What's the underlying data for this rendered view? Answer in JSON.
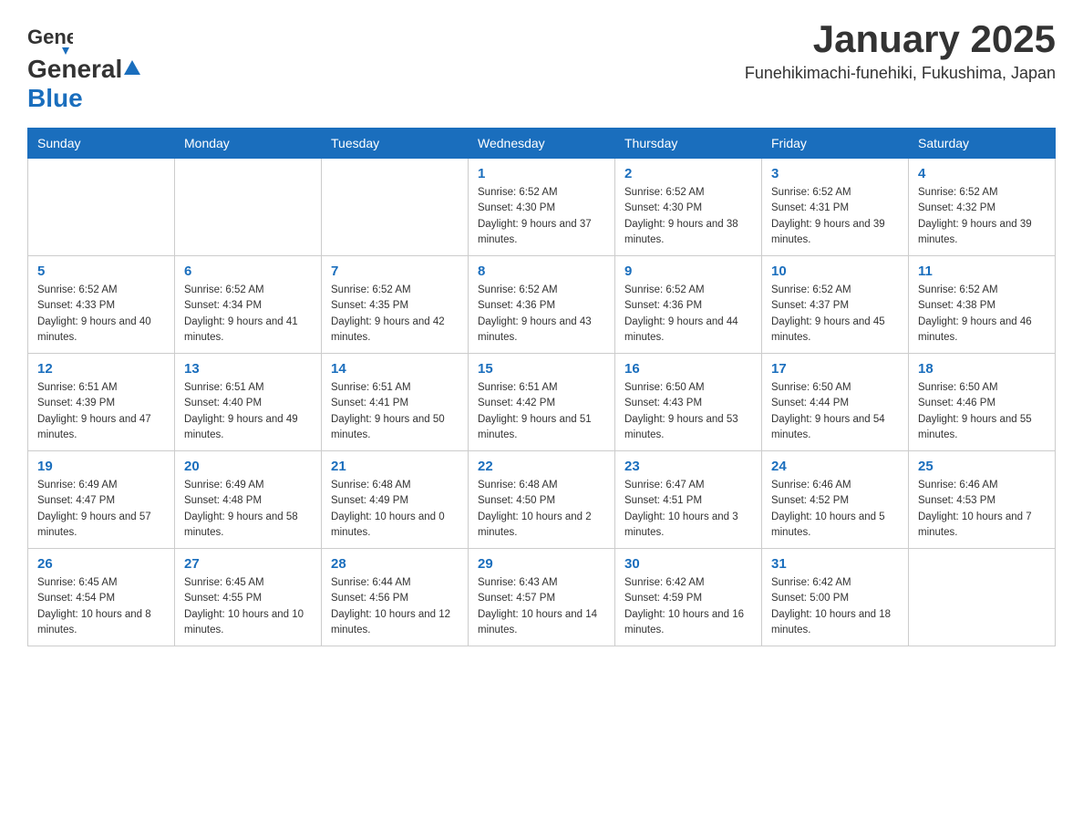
{
  "header": {
    "logo": {
      "general": "General",
      "blue": "Blue"
    },
    "title": "January 2025",
    "subtitle": "Funehikimachi-funehiki, Fukushima, Japan"
  },
  "days_of_week": [
    "Sunday",
    "Monday",
    "Tuesday",
    "Wednesday",
    "Thursday",
    "Friday",
    "Saturday"
  ],
  "weeks": [
    [
      {
        "day": "",
        "info": ""
      },
      {
        "day": "",
        "info": ""
      },
      {
        "day": "",
        "info": ""
      },
      {
        "day": "1",
        "info": "Sunrise: 6:52 AM\nSunset: 4:30 PM\nDaylight: 9 hours and 37 minutes."
      },
      {
        "day": "2",
        "info": "Sunrise: 6:52 AM\nSunset: 4:30 PM\nDaylight: 9 hours and 38 minutes."
      },
      {
        "day": "3",
        "info": "Sunrise: 6:52 AM\nSunset: 4:31 PM\nDaylight: 9 hours and 39 minutes."
      },
      {
        "day": "4",
        "info": "Sunrise: 6:52 AM\nSunset: 4:32 PM\nDaylight: 9 hours and 39 minutes."
      }
    ],
    [
      {
        "day": "5",
        "info": "Sunrise: 6:52 AM\nSunset: 4:33 PM\nDaylight: 9 hours and 40 minutes."
      },
      {
        "day": "6",
        "info": "Sunrise: 6:52 AM\nSunset: 4:34 PM\nDaylight: 9 hours and 41 minutes."
      },
      {
        "day": "7",
        "info": "Sunrise: 6:52 AM\nSunset: 4:35 PM\nDaylight: 9 hours and 42 minutes."
      },
      {
        "day": "8",
        "info": "Sunrise: 6:52 AM\nSunset: 4:36 PM\nDaylight: 9 hours and 43 minutes."
      },
      {
        "day": "9",
        "info": "Sunrise: 6:52 AM\nSunset: 4:36 PM\nDaylight: 9 hours and 44 minutes."
      },
      {
        "day": "10",
        "info": "Sunrise: 6:52 AM\nSunset: 4:37 PM\nDaylight: 9 hours and 45 minutes."
      },
      {
        "day": "11",
        "info": "Sunrise: 6:52 AM\nSunset: 4:38 PM\nDaylight: 9 hours and 46 minutes."
      }
    ],
    [
      {
        "day": "12",
        "info": "Sunrise: 6:51 AM\nSunset: 4:39 PM\nDaylight: 9 hours and 47 minutes."
      },
      {
        "day": "13",
        "info": "Sunrise: 6:51 AM\nSunset: 4:40 PM\nDaylight: 9 hours and 49 minutes."
      },
      {
        "day": "14",
        "info": "Sunrise: 6:51 AM\nSunset: 4:41 PM\nDaylight: 9 hours and 50 minutes."
      },
      {
        "day": "15",
        "info": "Sunrise: 6:51 AM\nSunset: 4:42 PM\nDaylight: 9 hours and 51 minutes."
      },
      {
        "day": "16",
        "info": "Sunrise: 6:50 AM\nSunset: 4:43 PM\nDaylight: 9 hours and 53 minutes."
      },
      {
        "day": "17",
        "info": "Sunrise: 6:50 AM\nSunset: 4:44 PM\nDaylight: 9 hours and 54 minutes."
      },
      {
        "day": "18",
        "info": "Sunrise: 6:50 AM\nSunset: 4:46 PM\nDaylight: 9 hours and 55 minutes."
      }
    ],
    [
      {
        "day": "19",
        "info": "Sunrise: 6:49 AM\nSunset: 4:47 PM\nDaylight: 9 hours and 57 minutes."
      },
      {
        "day": "20",
        "info": "Sunrise: 6:49 AM\nSunset: 4:48 PM\nDaylight: 9 hours and 58 minutes."
      },
      {
        "day": "21",
        "info": "Sunrise: 6:48 AM\nSunset: 4:49 PM\nDaylight: 10 hours and 0 minutes."
      },
      {
        "day": "22",
        "info": "Sunrise: 6:48 AM\nSunset: 4:50 PM\nDaylight: 10 hours and 2 minutes."
      },
      {
        "day": "23",
        "info": "Sunrise: 6:47 AM\nSunset: 4:51 PM\nDaylight: 10 hours and 3 minutes."
      },
      {
        "day": "24",
        "info": "Sunrise: 6:46 AM\nSunset: 4:52 PM\nDaylight: 10 hours and 5 minutes."
      },
      {
        "day": "25",
        "info": "Sunrise: 6:46 AM\nSunset: 4:53 PM\nDaylight: 10 hours and 7 minutes."
      }
    ],
    [
      {
        "day": "26",
        "info": "Sunrise: 6:45 AM\nSunset: 4:54 PM\nDaylight: 10 hours and 8 minutes."
      },
      {
        "day": "27",
        "info": "Sunrise: 6:45 AM\nSunset: 4:55 PM\nDaylight: 10 hours and 10 minutes."
      },
      {
        "day": "28",
        "info": "Sunrise: 6:44 AM\nSunset: 4:56 PM\nDaylight: 10 hours and 12 minutes."
      },
      {
        "day": "29",
        "info": "Sunrise: 6:43 AM\nSunset: 4:57 PM\nDaylight: 10 hours and 14 minutes."
      },
      {
        "day": "30",
        "info": "Sunrise: 6:42 AM\nSunset: 4:59 PM\nDaylight: 10 hours and 16 minutes."
      },
      {
        "day": "31",
        "info": "Sunrise: 6:42 AM\nSunset: 5:00 PM\nDaylight: 10 hours and 18 minutes."
      },
      {
        "day": "",
        "info": ""
      }
    ]
  ]
}
